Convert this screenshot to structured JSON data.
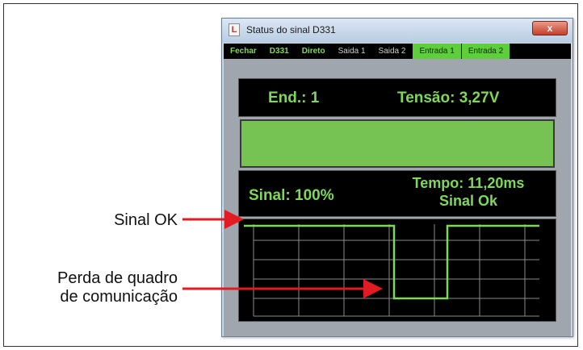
{
  "window": {
    "title": "Status do sinal D331",
    "close_symbol": "x"
  },
  "menubar": {
    "items": [
      "Fechar",
      "D331",
      "Direto",
      "Saida 1",
      "Saida 2",
      "Entrada 1",
      "Entrada 2"
    ]
  },
  "readings": {
    "endereco": "End.: 1",
    "tensao": "Tensão: 3,27V",
    "sinal": "Sinal: 100%",
    "tempo": "Tempo: 11,20ms",
    "status": "Sinal Ok"
  },
  "callouts": {
    "sinal_ok": "Sinal OK",
    "perda_line1": "Perda de quadro",
    "perda_line2": "de comunicação"
  },
  "colors": {
    "accent_green": "#7ed85a",
    "arrow_red": "#e21b22",
    "signal_bar": "#76c354"
  }
}
